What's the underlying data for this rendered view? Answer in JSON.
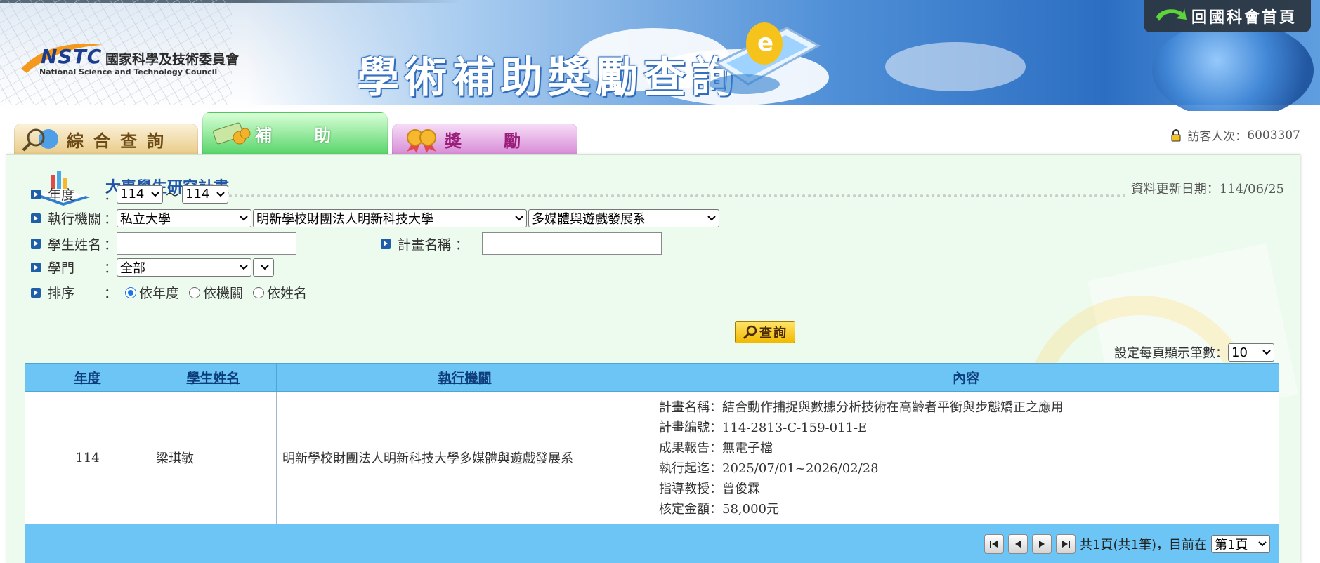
{
  "header": {
    "logo_abbr": "NSTC",
    "logo_cn": "國家科學及技術委員會",
    "logo_en": "National Science and Technology Council",
    "site_title": "學術補助獎勵查詢",
    "home_link": "回國科會首頁"
  },
  "tabs": [
    {
      "label": "綜合查詢",
      "icon": "magnifier-globe-icon",
      "active": false
    },
    {
      "label": "補助",
      "icon": "money-stack-icon",
      "active": true
    },
    {
      "label": "獎勵",
      "icon": "medal-icon",
      "active": false
    }
  ],
  "visitor": {
    "label": "訪客人次：",
    "count": "6003307"
  },
  "section": {
    "title": "大專學生研究計畫",
    "updated_label": "資料更新日期：",
    "updated_value": "114/06/25"
  },
  "form": {
    "year": {
      "label": "年度",
      "colon": "：",
      "from": "114",
      "sep": "～",
      "to": "114"
    },
    "org": {
      "label": "執行機關",
      "colon": "：",
      "type": "私立大學",
      "school": "明新學校財團法人明新科技大學",
      "dept": "多媒體與遊戲發展系"
    },
    "student": {
      "label": "學生姓名",
      "colon": "：",
      "value": ""
    },
    "project": {
      "label": "計畫名稱",
      "colon": "：",
      "value": ""
    },
    "field": {
      "label": "學門",
      "colon": "：",
      "value": "全部",
      "sub_value": ""
    },
    "sort": {
      "label": "排序",
      "colon": "：",
      "options": [
        "依年度",
        "依機關",
        "依姓名"
      ],
      "selected": "依年度"
    },
    "query_button": "查詢",
    "per_page_label": "設定每頁顯示筆數：",
    "per_page_value": "10"
  },
  "table": {
    "headers": [
      "年度",
      "學生姓名",
      "執行機關",
      "內容"
    ],
    "rows": [
      {
        "year": "114",
        "name": "梁琪敏",
        "org": "明新學校財團法人明新科技大學多媒體與遊戲發展系",
        "content": [
          {
            "label": "計畫名稱：",
            "value": "結合動作捕捉與數據分析技術在高齡者平衡與步態矯正之應用"
          },
          {
            "label": "計畫編號：",
            "value": "114-2813-C-159-011-E"
          },
          {
            "label": "成果報告：",
            "value": "無電子檔"
          },
          {
            "label": "執行起迄：",
            "value": "2025/07/01~2026/02/28"
          },
          {
            "label": "指導教授：",
            "value": "曾俊霖"
          },
          {
            "label": "核定金額：",
            "value": "58,000元"
          }
        ]
      }
    ]
  },
  "pager": {
    "summary": "共1頁(共1筆)，目前在",
    "current_page": "第1頁"
  },
  "colors": {
    "panel_bg": "#edfaee",
    "table_header_bg": "#6cc5f4",
    "title_blue": "#1e55a8",
    "query_button": "#f1b900"
  }
}
